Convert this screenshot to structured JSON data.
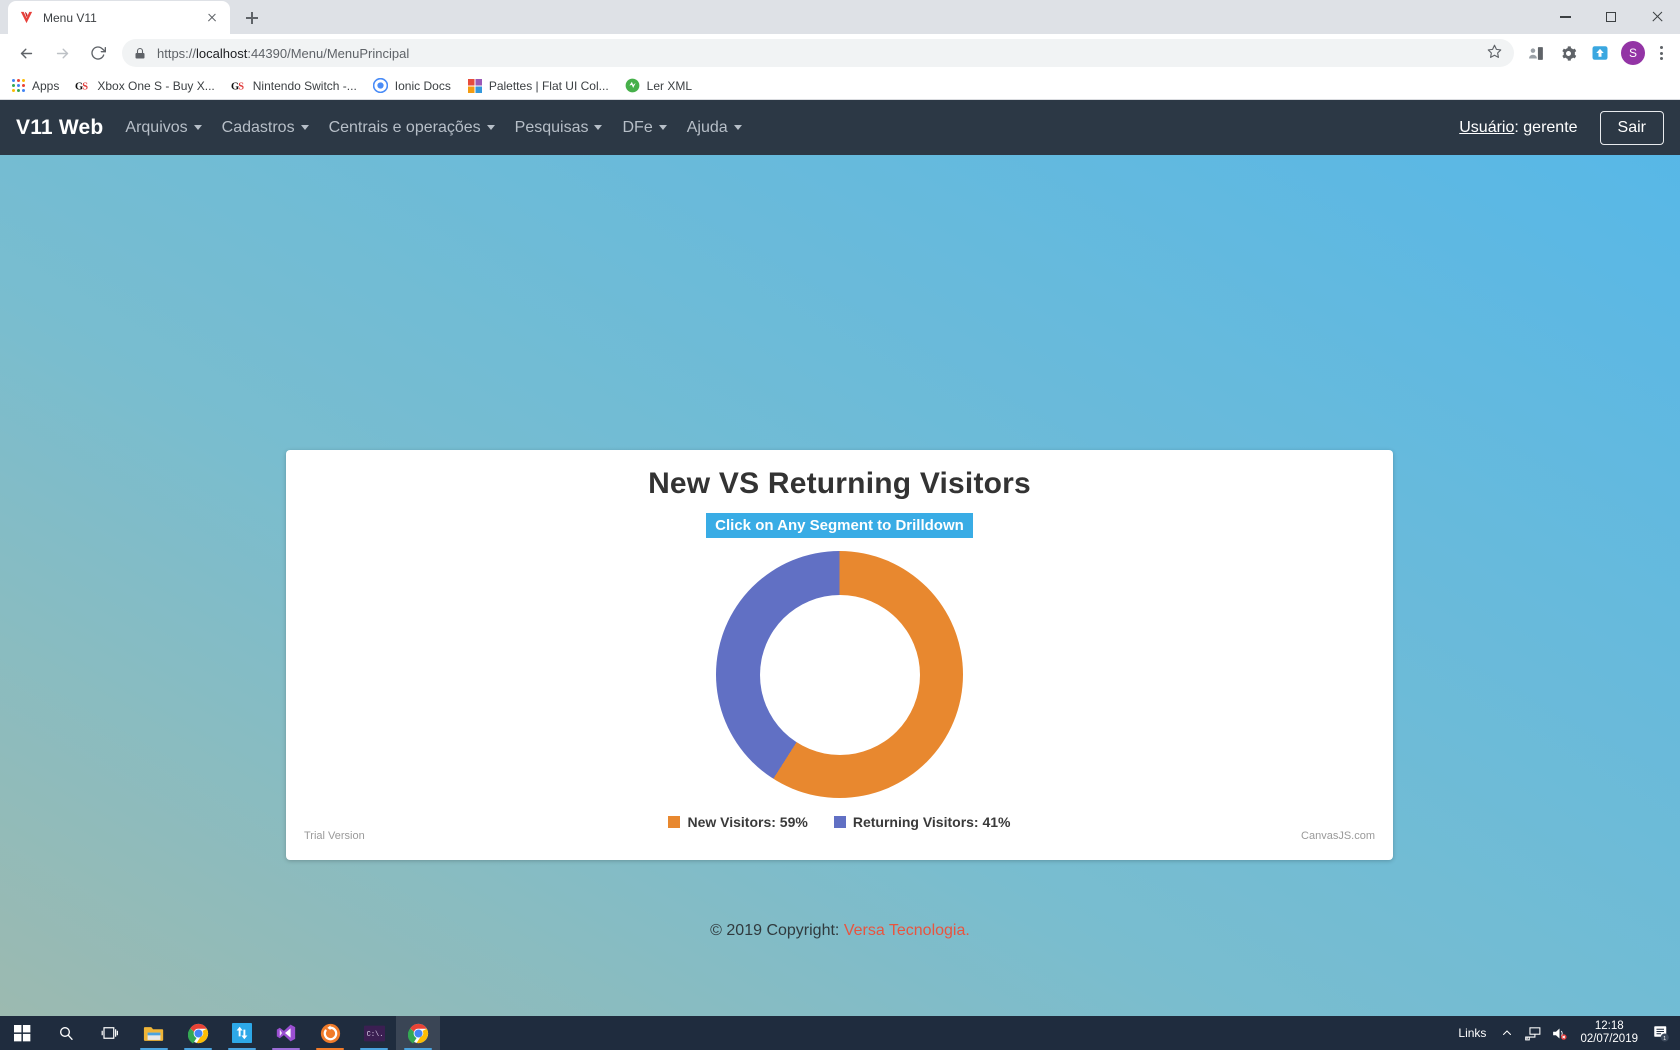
{
  "browser": {
    "tab": {
      "title": "Menu V11",
      "favicon": "versa-logo-icon",
      "close_icon": "close-icon"
    },
    "newtab_tooltip": "New Tab",
    "window_controls": {
      "minimize": "minimize-icon",
      "maximize": "maximize-icon",
      "close": "close-icon"
    },
    "nav": {
      "back": "back-arrow-icon",
      "forward": "forward-arrow-icon",
      "reload": "reload-icon"
    },
    "omnibox": {
      "lock_icon": "lock-icon",
      "scheme": "https://",
      "host": "localhost",
      "path": ":44390/Menu/MenuPrincipal",
      "full_url": "https://localhost:44390/Menu/MenuPrincipal",
      "star_icon": "bookmark-star-icon"
    },
    "toolbar_icons": [
      "profile-card-icon",
      "gear-extension-icon",
      "save-to-drive-icon"
    ],
    "profile_initial": "S",
    "menu_icon": "three-dot-menu-icon",
    "bookmarks": [
      {
        "label": "Apps",
        "icon": "apps-grid-icon"
      },
      {
        "label": "Xbox One S - Buy X...",
        "icon": "gs-icon"
      },
      {
        "label": "Nintendo Switch -...",
        "icon": "gs-icon"
      },
      {
        "label": "Ionic Docs",
        "icon": "ionic-icon"
      },
      {
        "label": "Palettes | Flat UI Col...",
        "icon": "palette-icon"
      },
      {
        "label": "Ler XML",
        "icon": "green-shield-icon"
      }
    ]
  },
  "app": {
    "brand": "V11 Web",
    "menu": [
      {
        "label": "Arquivos",
        "has_caret": true
      },
      {
        "label": "Cadastros",
        "has_caret": true
      },
      {
        "label": "Centrais e operações",
        "has_caret": true
      },
      {
        "label": "Pesquisas",
        "has_caret": true
      },
      {
        "label": "DFe",
        "has_caret": true
      },
      {
        "label": "Ajuda",
        "has_caret": true
      }
    ],
    "user_label": "Usuário",
    "user_separator": ": ",
    "user_name": "gerente",
    "logout_label": "Sair",
    "footer_prefix": "© 2019 Copyright: ",
    "footer_link": "Versa Tecnologia."
  },
  "chart_data": {
    "type": "pie",
    "variant": "doughnut",
    "title": "New VS Returning Visitors",
    "subtitle": "Click on Any Segment to Drilldown",
    "labels": [
      "New Visitors",
      "Returning Visitors"
    ],
    "values": [
      59,
      41
    ],
    "unit": "%",
    "colors": [
      "#e8882f",
      "#6170c4"
    ],
    "legend": [
      {
        "text": "New Visitors: 59%",
        "color": "#e8882f"
      },
      {
        "text": "Returning Visitors: 41%",
        "color": "#6170c4"
      }
    ],
    "legend_position": "bottom",
    "watermark": "Trial Version",
    "credit": "CanvasJS.com",
    "subtitle_bg": "#39ace5",
    "start_angle_deg": 0,
    "inner_radius_ratio": 0.65
  },
  "taskbar": {
    "items": [
      {
        "icon": "windows-start-icon",
        "name": "start-button",
        "underline": ""
      },
      {
        "icon": "search-icon",
        "name": "search-button",
        "underline": ""
      },
      {
        "icon": "task-view-icon",
        "name": "task-view-button",
        "underline": ""
      },
      {
        "icon": "file-explorer-icon",
        "name": "file-explorer",
        "underline": "#4aa3df"
      },
      {
        "icon": "chrome-icon",
        "name": "chrome-window-1",
        "underline": "#4aa3df"
      },
      {
        "icon": "filezilla-icon",
        "name": "filezilla",
        "underline": "#4aa3df"
      },
      {
        "icon": "visual-studio-icon",
        "name": "visual-studio",
        "underline": "#9b6dd6"
      },
      {
        "icon": "sync-icon",
        "name": "sync-app",
        "underline": "#f07b2a"
      },
      {
        "icon": "terminal-icon",
        "name": "terminal",
        "underline": "#4aa3df"
      },
      {
        "icon": "chrome-icon",
        "name": "chrome-window-2",
        "underline": "#4aa3df"
      }
    ],
    "tray_label": "Links",
    "tray_chevron": "chevron-up-icon",
    "tray_icons": [
      "network-icon",
      "volume-muted-icon"
    ],
    "time": "12:18",
    "date": "02/07/2019",
    "notifications_icon": "action-center-icon",
    "notifications_count": "1"
  }
}
